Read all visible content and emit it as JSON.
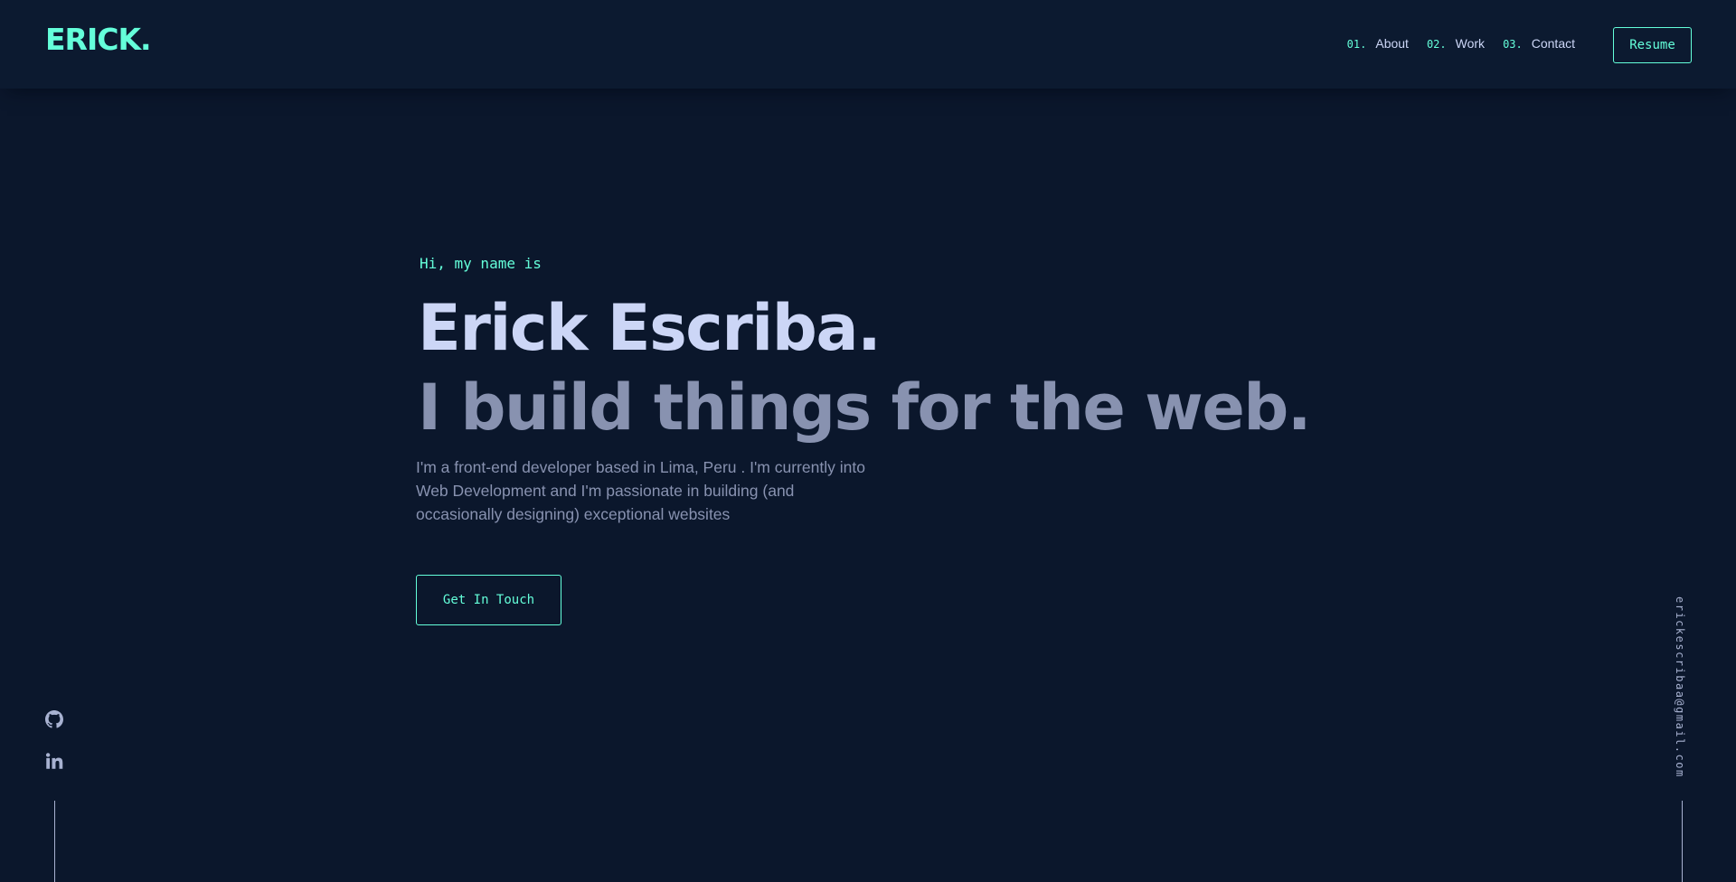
{
  "header": {
    "logo": "ERICK.",
    "nav": [
      {
        "num": "01.",
        "label": "About"
      },
      {
        "num": "02.",
        "label": "Work"
      },
      {
        "num": "03.",
        "label": "Contact"
      }
    ],
    "resume_label": "Resume"
  },
  "hero": {
    "greeting": "Hi, my name is",
    "name": "Erick Escriba.",
    "tagline": "I build things for the web.",
    "description": "I'm a front-end developer based in Lima, Peru . I'm currently into Web Development and I'm passionate in building (and occasionally designing) exceptional websites",
    "cta_label": "Get In Touch"
  },
  "social": {
    "icons": [
      "github-icon",
      "linkedin-icon"
    ]
  },
  "email": "erickescribaa@gmail.com",
  "colors": {
    "background": "#0b172c",
    "accent": "#64ffda",
    "heading": "#ccd6f6",
    "body_text": "#8892b0"
  }
}
